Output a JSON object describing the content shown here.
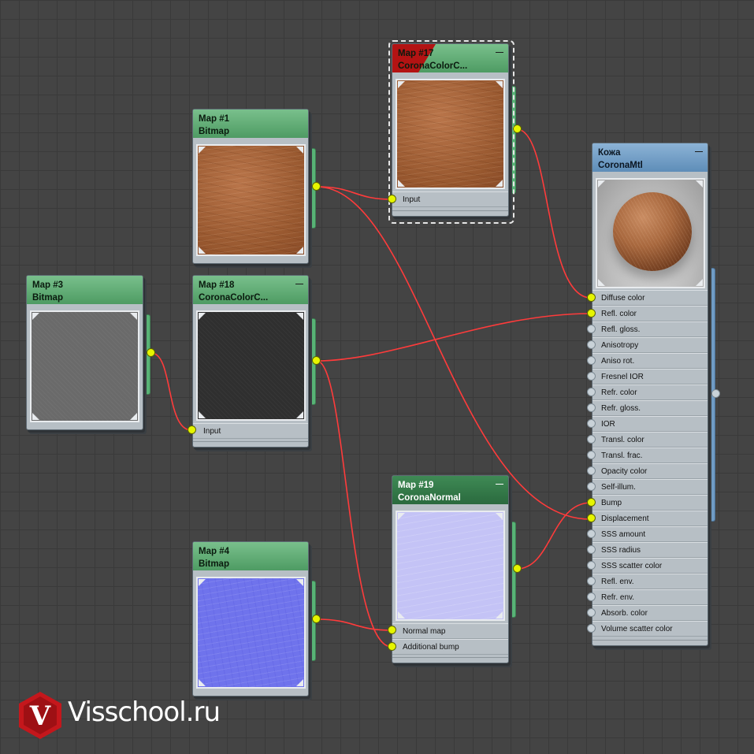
{
  "nodes": {
    "map17": {
      "title": "Map #17",
      "type": "CoronaColorC...",
      "slots": [
        "Input"
      ]
    },
    "map1": {
      "title": "Map #1",
      "type": "Bitmap"
    },
    "map3": {
      "title": "Map #3",
      "type": "Bitmap"
    },
    "map18": {
      "title": "Map #18",
      "type": "CoronaColorC...",
      "slots": [
        "Input"
      ]
    },
    "map4": {
      "title": "Map #4",
      "type": "Bitmap"
    },
    "map19": {
      "title": "Map #19",
      "type": "CoronaNormal",
      "slots": [
        "Normal map",
        "Additional bump"
      ]
    },
    "mtl": {
      "title": "Кожа",
      "type": "CoronaMtl",
      "slots": [
        "Diffuse color",
        "Refl. color",
        "Refl. gloss.",
        "Anisotropy",
        "Aniso rot.",
        "Fresnel IOR",
        "Refr. color",
        "Refr. gloss.",
        "IOR",
        "Transl. color",
        "Transl. frac.",
        "Opacity color",
        "Self-illum.",
        "Bump",
        "Displacement",
        "SSS amount",
        "SSS radius",
        "SSS scatter color",
        "Refl. env.",
        "Refr. env.",
        "Absorb. color",
        "Volume scatter color"
      ],
      "connected": [
        0,
        1,
        13,
        14
      ]
    }
  },
  "minimize_glyph": "—",
  "brand": {
    "text": "Visschool.ru",
    "logo_letter": "V",
    "color": "#c4171c"
  },
  "colors": {
    "wire": "#ff3b3b",
    "socket": "#e6f500",
    "node_head": "#5fae76",
    "mtl_head": "#6f9bc4"
  }
}
